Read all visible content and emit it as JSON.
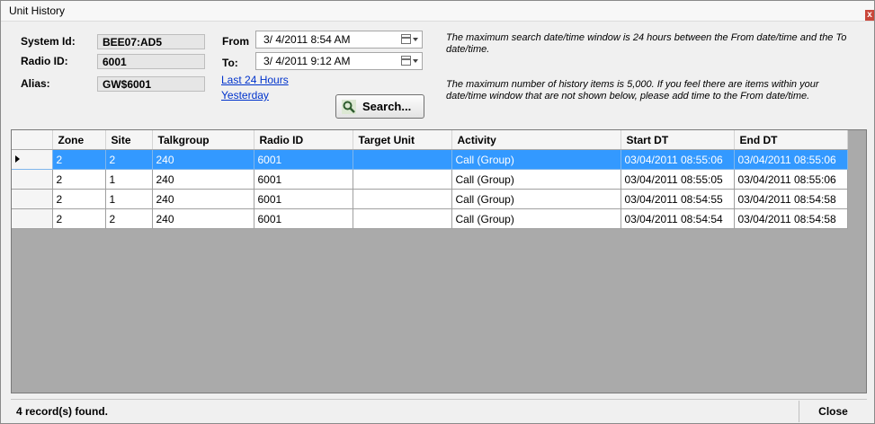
{
  "window": {
    "title": "Unit History",
    "close_glyph": "x"
  },
  "filters": {
    "system_id_label": "System Id:",
    "system_id_value": "BEE07:AD5",
    "radio_id_label": "Radio ID:",
    "radio_id_value": "6001",
    "alias_label": "Alias:",
    "alias_value": "GW$6001",
    "from_label": "From",
    "from_value": "3/ 4/2011   8:54 AM",
    "to_label": "To:",
    "to_value": "3/ 4/2011   9:12 AM",
    "last24_link": "Last 24 Hours",
    "yesterday_link": "Yesterday",
    "search_button": "Search..."
  },
  "info": {
    "line1": "The maximum search date/time window is 24 hours between the From date/time and the To date/time.",
    "line2": "The maximum number of history items is 5,000.  If you feel there are items within your date/time window that are not shown below, please add time to the From date/time."
  },
  "table": {
    "columns": [
      "Zone",
      "Site",
      "Talkgroup",
      "Radio ID",
      "Target Unit",
      "Activity",
      "Start DT",
      "End DT"
    ],
    "rows": [
      [
        "2",
        "2",
        "240",
        "6001",
        "",
        "Call (Group)",
        "03/04/2011 08:55:06",
        "03/04/2011 08:55:06"
      ],
      [
        "2",
        "1",
        "240",
        "6001",
        "",
        "Call (Group)",
        "03/04/2011 08:55:05",
        "03/04/2011 08:55:06"
      ],
      [
        "2",
        "1",
        "240",
        "6001",
        "",
        "Call (Group)",
        "03/04/2011 08:54:55",
        "03/04/2011 08:54:58"
      ],
      [
        "2",
        "2",
        "240",
        "6001",
        "",
        "Call (Group)",
        "03/04/2011 08:54:54",
        "03/04/2011 08:54:58"
      ]
    ],
    "selected_row": 0,
    "selection_color": "#3399ff"
  },
  "status": {
    "text": "4 record(s) found.",
    "close_button": "Close"
  }
}
